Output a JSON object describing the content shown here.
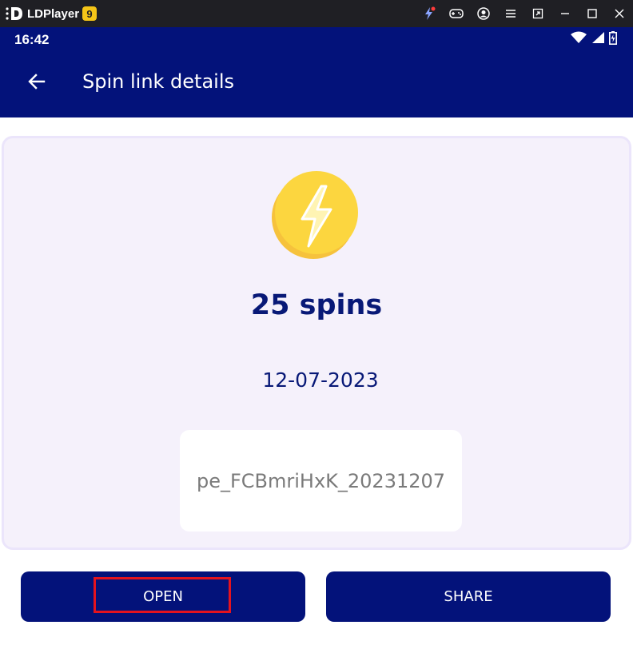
{
  "window": {
    "app_name": "LDPlayer",
    "badge": "9",
    "icons": [
      "lightning-icon",
      "gamepad-icon",
      "account-icon",
      "menu-icon",
      "restore-icon",
      "minimize-icon",
      "maximize-icon",
      "close-icon"
    ],
    "colors": {
      "titlebar": "#1f1f24",
      "badge": "#f5c518"
    }
  },
  "status_bar": {
    "time": "16:42",
    "icons": [
      "wifi-icon",
      "signal-icon",
      "battery-icon"
    ]
  },
  "app_bar": {
    "title": "Spin link details",
    "back_icon": "arrow-left-icon",
    "color": "#03127a"
  },
  "card": {
    "icon": "lightning-coin-icon",
    "spins": "25 spins",
    "date": "12-07-2023",
    "code": "pe_FCBmriHxK_20231207",
    "colors": {
      "background": "#f5f1fb",
      "text": "#081977",
      "code_text": "#7a7a7a"
    }
  },
  "actions": {
    "open_label": "OPEN",
    "share_label": "SHARE",
    "highlight_color": "#e4131e"
  }
}
